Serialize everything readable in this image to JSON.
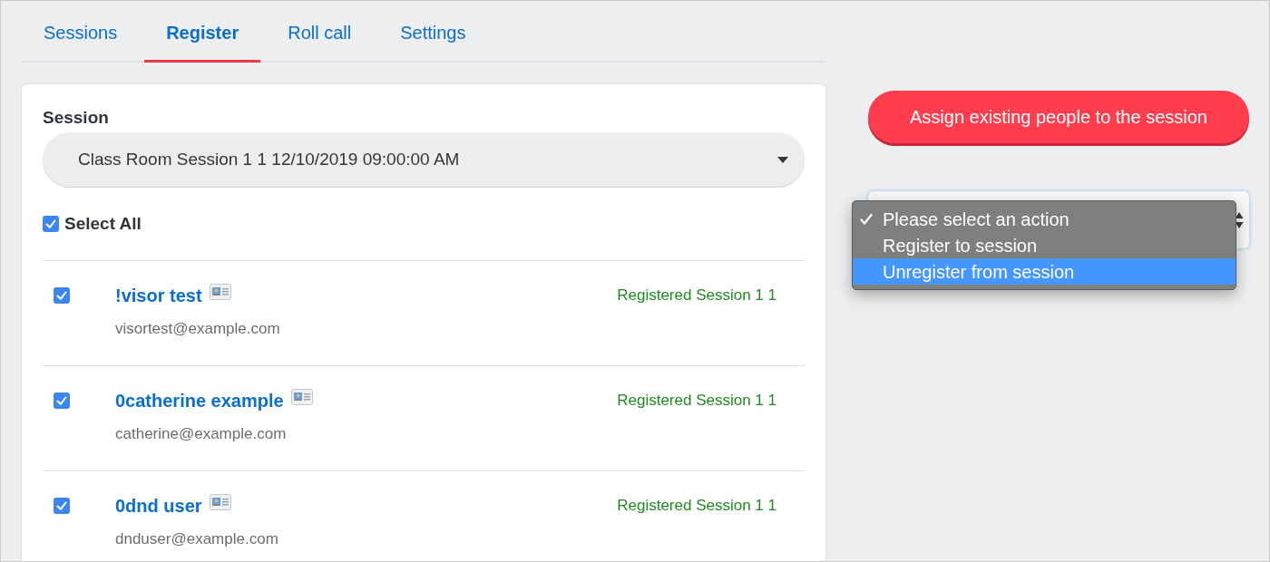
{
  "tabs": [
    {
      "label": "Sessions",
      "selected": false
    },
    {
      "label": "Register",
      "selected": true
    },
    {
      "label": "Roll call",
      "selected": false
    },
    {
      "label": "Settings",
      "selected": false
    }
  ],
  "session": {
    "label": "Session",
    "value": "Class Room Session 1 1 12/10/2019 09:00:00 AM"
  },
  "select_all": {
    "label": "Select All",
    "checked": true
  },
  "people": [
    {
      "name": "!visor test",
      "email": "visortest@example.com",
      "status": "Registered Session 1 1",
      "checked": true
    },
    {
      "name": "0catherine example",
      "email": "catherine@example.com",
      "status": "Registered Session 1 1",
      "checked": true
    },
    {
      "name": "0dnd user",
      "email": "dnduser@example.com",
      "status": "Registered Session 1 1",
      "checked": true
    }
  ],
  "assign_button": {
    "label": "Assign existing people to the session"
  },
  "action_select": {
    "options": [
      {
        "label": "Please select an action",
        "selected": true,
        "highlighted": false
      },
      {
        "label": "Register to session",
        "selected": false,
        "highlighted": false
      },
      {
        "label": "Unregister from session",
        "selected": false,
        "highlighted": true
      }
    ]
  }
}
